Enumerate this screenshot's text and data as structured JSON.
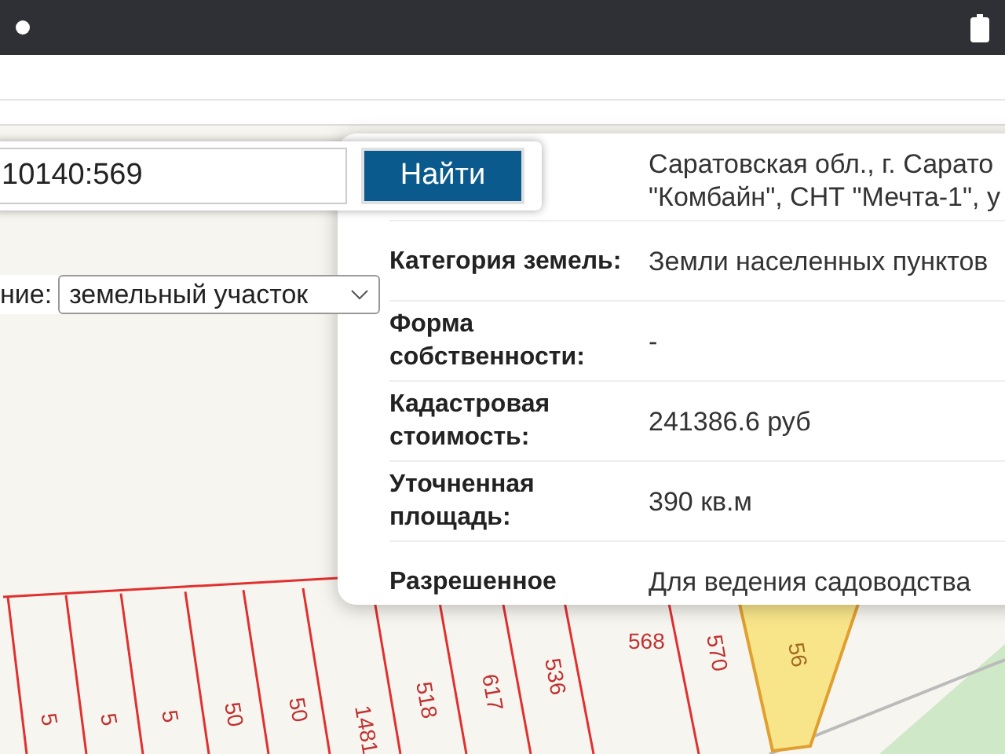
{
  "search": {
    "value": "10140:569",
    "button": "Найти"
  },
  "filter": {
    "label": "ние:",
    "value": "земельный участок"
  },
  "info": {
    "rows": [
      {
        "label": "",
        "value_lines": [
          "Саратовская обл., г. Сарато",
          "\"Комбайн\", СНТ \"Мечта-1\", у"
        ]
      },
      {
        "label": "Категория земель:",
        "value_lines": [
          "Земли населенных пунктов"
        ]
      },
      {
        "label": "Форма собственности:",
        "value_lines": [
          "-"
        ]
      },
      {
        "label": "Кадастровая стоимость:",
        "value_lines": [
          "241386.6 руб"
        ]
      },
      {
        "label": "Уточненная площадь:",
        "value_lines": [
          "390 кв.м"
        ]
      },
      {
        "label": "Разрешенное",
        "value_lines": [
          "Для ведения садоводства"
        ]
      }
    ]
  },
  "map": {
    "parcels": [
      {
        "label": "5",
        "selected": false
      },
      {
        "label": "5",
        "selected": false
      },
      {
        "label": "5",
        "selected": false
      },
      {
        "label": "50",
        "selected": false
      },
      {
        "label": "50",
        "selected": false
      },
      {
        "label": "1481",
        "selected": false
      },
      {
        "label": "518",
        "selected": false
      },
      {
        "label": "617",
        "selected": false
      },
      {
        "label": "536",
        "selected": false
      },
      {
        "label": "568",
        "selected": false
      },
      {
        "label": "570",
        "selected": false
      },
      {
        "label": "56",
        "selected": true
      }
    ]
  }
}
